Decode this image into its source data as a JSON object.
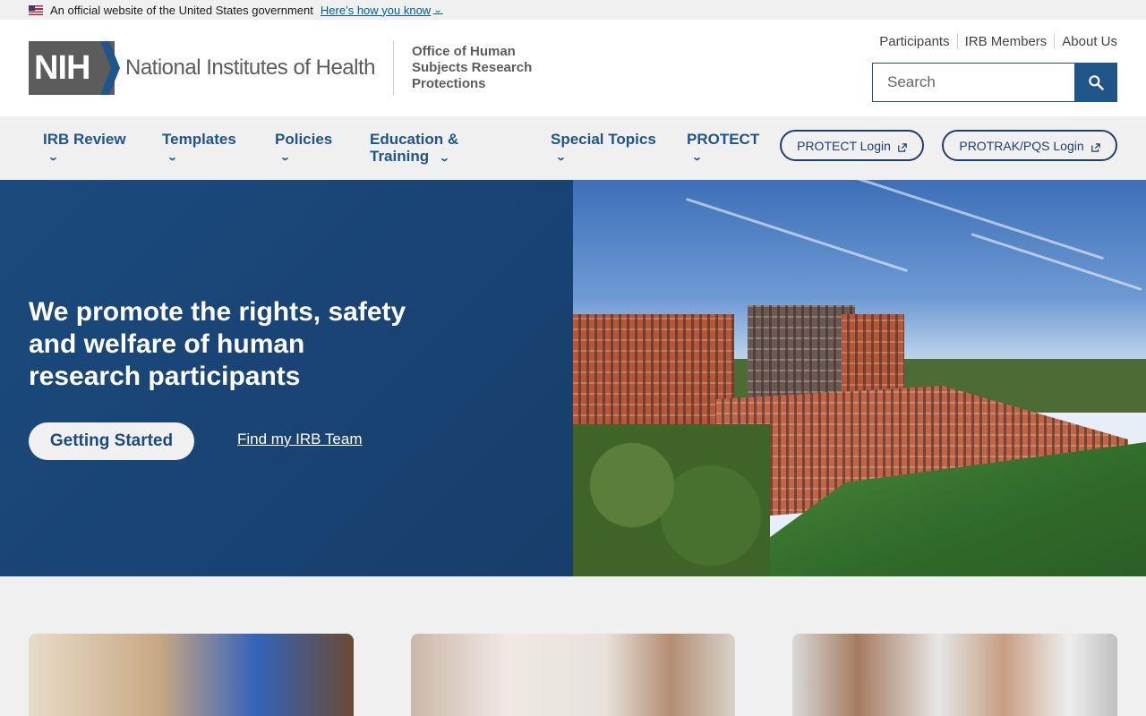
{
  "gov_banner": {
    "text": "An official website of the United States government",
    "link_label": "Here’s how you know",
    "icon": "us-flag-icon"
  },
  "header": {
    "logo_abbrev": "NIH",
    "logo_name": "National Institutes of Health",
    "office_name": "Office of Human Subjects Research Protections",
    "utility_links": [
      "Participants",
      "IRB Members",
      "About Us"
    ],
    "search_placeholder": "Search",
    "search_icon": "search-icon"
  },
  "nav": {
    "items": [
      {
        "label": "IRB Review"
      },
      {
        "label": "Templates"
      },
      {
        "label": "Policies"
      },
      {
        "label": "Education & Training"
      },
      {
        "label": "Special Topics"
      },
      {
        "label": "PROTECT"
      }
    ],
    "buttons": [
      {
        "label": "PROTECT Login",
        "icon": "external-link-icon"
      },
      {
        "label": "PROTRAK/PQS Login",
        "icon": "external-link-icon"
      }
    ]
  },
  "hero": {
    "title": "We promote the rights, safety and welfare of human research participants",
    "primary_button": "Getting Started",
    "secondary_link": "Find my IRB Team"
  },
  "colors": {
    "brand_blue": "#20558a",
    "hero_blue": "#1b4a7e",
    "nav_bg": "#f0f0f0"
  }
}
